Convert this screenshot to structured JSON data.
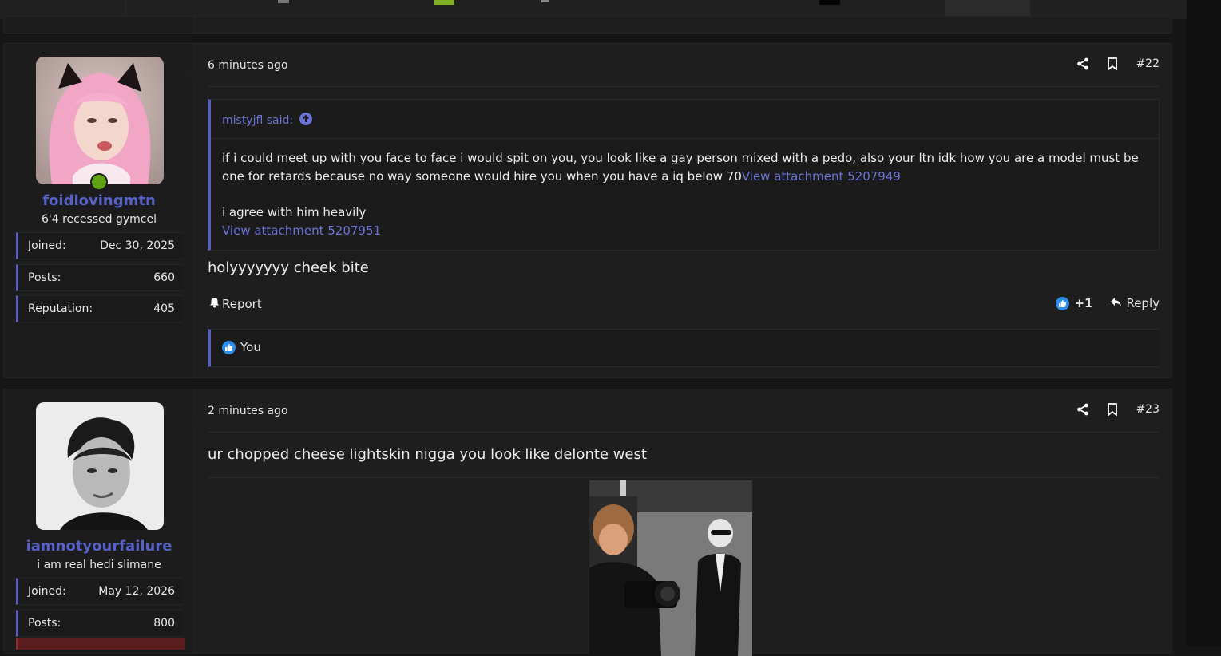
{
  "posts": [
    {
      "number": "#22",
      "timestamp": "6 minutes ago",
      "user": {
        "name": "foidlovingmtn",
        "title": "6'4 recessed gymcel",
        "stats": [
          {
            "label": "Joined:",
            "value": "Dec 30, 2025"
          },
          {
            "label": "Posts:",
            "value": "660"
          },
          {
            "label": "Reputation:",
            "value": "405"
          }
        ],
        "online": true
      },
      "quote": {
        "author": "mistyjfl said:",
        "text1": "if i could meet up with you face to face i would spit on you, you look like a gay person mixed with a pedo, also your ltn idk how you are a model must be one for retards because no way someone would hire you when you have a iq below 70",
        "link1": "View attachment 5207949",
        "text2": "i agree with him heavily",
        "link2": "View attachment 5207951"
      },
      "body": "holyyyyyyy cheek bite",
      "report_label": "Report",
      "reaction_count": "+1",
      "reply_label": "Reply",
      "reacted_by": "You"
    },
    {
      "number": "#23",
      "timestamp": "2 minutes ago",
      "user": {
        "name": "iamnotyourfailure",
        "title": "i am real hedi slimane",
        "stats": [
          {
            "label": "Joined:",
            "value": "May 12, 2026"
          },
          {
            "label": "Posts:",
            "value": "800"
          }
        ]
      },
      "body": "ur chopped cheese lightskin nigga you look like delonte west"
    }
  ],
  "icons": {
    "share": "share-icon",
    "bookmark": "bookmark-icon",
    "quote_arrow": "arrow-up-circle-icon",
    "report": "bell-icon",
    "like": "thumbs-up-icon",
    "reply": "reply-icon"
  },
  "colors": {
    "accent": "#5a5fb8",
    "username": "#5560c8",
    "link": "#6a74d6",
    "online": "#5fa213",
    "like": "#2f8ce8"
  }
}
